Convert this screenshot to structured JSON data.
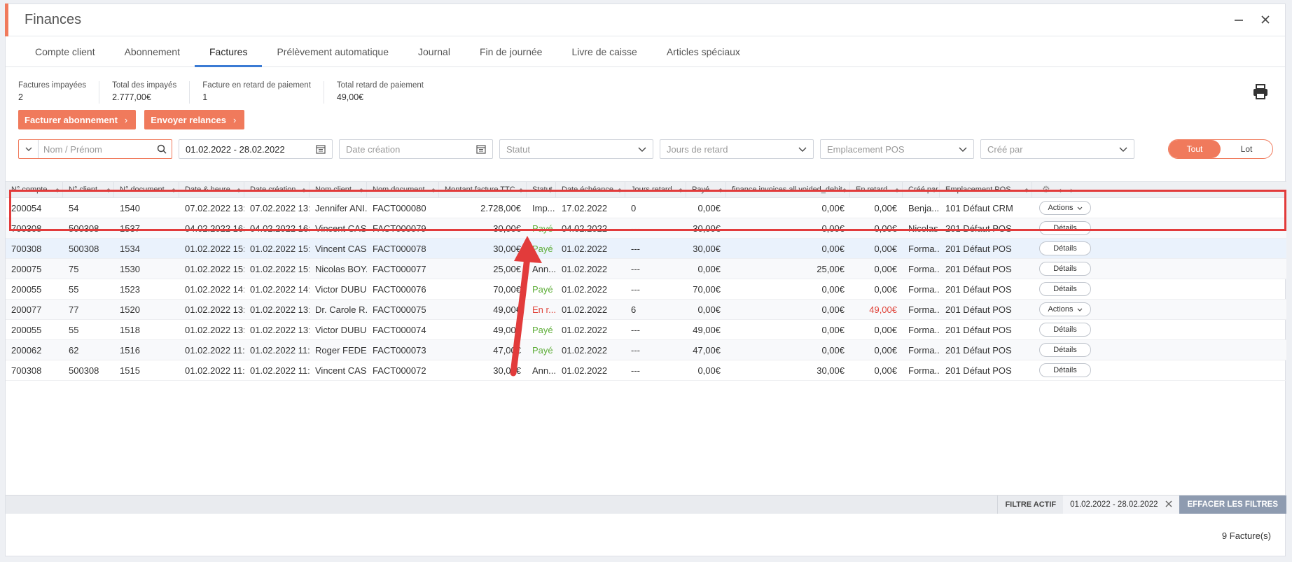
{
  "window": {
    "title": "Finances"
  },
  "tabs": [
    {
      "label": "Compte client",
      "active": false
    },
    {
      "label": "Abonnement",
      "active": false
    },
    {
      "label": "Factures",
      "active": true
    },
    {
      "label": "Prélèvement automatique",
      "active": false
    },
    {
      "label": "Journal",
      "active": false
    },
    {
      "label": "Fin de journée",
      "active": false
    },
    {
      "label": "Livre de caisse",
      "active": false
    },
    {
      "label": "Articles spéciaux",
      "active": false
    }
  ],
  "stats": [
    {
      "label": "Factures impayées",
      "value": "2"
    },
    {
      "label": "Total des impayés",
      "value": "2.777,00€"
    },
    {
      "label": "Facture en retard de paiement",
      "value": "1"
    },
    {
      "label": "Total retard de paiement",
      "value": "49,00€"
    }
  ],
  "actions": {
    "bill_label": "Facturer abonnement",
    "remind_label": "Envoyer relances"
  },
  "filters": {
    "name_placeholder": "Nom / Prénom",
    "date_range": "01.02.2022 - 28.02.2022",
    "date_creation_placeholder": "Date création",
    "statut_placeholder": "Statut",
    "jours_placeholder": "Jours de retard",
    "pos_placeholder": "Emplacement POS",
    "cree_placeholder": "Créé par",
    "toggle_all": "Tout",
    "toggle_lot": "Lot"
  },
  "columns": [
    "N° compte",
    "N° client",
    "N° document",
    "Date & heure",
    "Date création",
    "Nom client",
    "Nom document",
    "Montant facture TTC",
    "Statut",
    "Date échéance",
    "Jours retard",
    "Payé",
    "finance.invoices.all.voided_debit",
    "En retard",
    "Créé par",
    "Emplacement POS"
  ],
  "rows": [
    {
      "compte": "200054",
      "client": "54",
      "doc": "1540",
      "dateheure": "07.02.2022 13:...",
      "creation": "07.02.2022 13:...",
      "nom": "Jennifer ANI...",
      "nomdoc": "FACT000080",
      "montant": "2.728,00€",
      "statut": "Imp...",
      "statut_type": "imp",
      "echeance": "17.02.2022",
      "jours": "0",
      "paye": "0,00€",
      "voided": "0,00€",
      "retard": "0,00€",
      "cree": "Benja...",
      "pos": "101 Défaut CRM",
      "btn": "Actions"
    },
    {
      "compte": "700308",
      "client": "500308",
      "doc": "1537",
      "dateheure": "04.02.2022 16:...",
      "creation": "04.02.2022 16:...",
      "nom": "Vincent CAS...",
      "nomdoc": "FACT000079",
      "montant": "30,00€",
      "statut": "Payé",
      "statut_type": "paid",
      "echeance": "04.02.2022",
      "jours": "---",
      "paye": "30,00€",
      "voided": "0,00€",
      "retard": "0,00€",
      "cree": "Nicolas",
      "pos": "201 Défaut POS",
      "btn": "Détails"
    },
    {
      "compte": "700308",
      "client": "500308",
      "doc": "1534",
      "dateheure": "01.02.2022 15:...",
      "creation": "01.02.2022 15:...",
      "nom": "Vincent CAS...",
      "nomdoc": "FACT000078",
      "montant": "30,00€",
      "statut": "Payé",
      "statut_type": "paid",
      "echeance": "01.02.2022",
      "jours": "---",
      "paye": "30,00€",
      "voided": "0,00€",
      "retard": "0,00€",
      "cree": "Forma...",
      "pos": "201 Défaut POS",
      "btn": "Détails"
    },
    {
      "compte": "200075",
      "client": "75",
      "doc": "1530",
      "dateheure": "01.02.2022 15:...",
      "creation": "01.02.2022 15:...",
      "nom": "Nicolas BOY...",
      "nomdoc": "FACT000077",
      "montant": "25,00€",
      "statut": "Ann...",
      "statut_type": "ann",
      "echeance": "01.02.2022",
      "jours": "---",
      "paye": "0,00€",
      "voided": "25,00€",
      "retard": "0,00€",
      "cree": "Forma...",
      "pos": "201 Défaut POS",
      "btn": "Détails"
    },
    {
      "compte": "200055",
      "client": "55",
      "doc": "1523",
      "dateheure": "01.02.2022 14:...",
      "creation": "01.02.2022 14:...",
      "nom": "Victor DUBU...",
      "nomdoc": "FACT000076",
      "montant": "70,00€",
      "statut": "Payé",
      "statut_type": "paid",
      "echeance": "01.02.2022",
      "jours": "---",
      "paye": "70,00€",
      "voided": "0,00€",
      "retard": "0,00€",
      "cree": "Forma...",
      "pos": "201 Défaut POS",
      "btn": "Détails"
    },
    {
      "compte": "200077",
      "client": "77",
      "doc": "1520",
      "dateheure": "01.02.2022 13:...",
      "creation": "01.02.2022 13:...",
      "nom": "Dr. Carole R...",
      "nomdoc": "FACT000075",
      "montant": "49,00€",
      "statut": "En r...",
      "statut_type": "late",
      "echeance": "01.02.2022",
      "jours": "6",
      "paye": "0,00€",
      "voided": "0,00€",
      "retard": "49,00€",
      "cree": "Forma...",
      "pos": "201 Défaut POS",
      "btn": "Actions"
    },
    {
      "compte": "200055",
      "client": "55",
      "doc": "1518",
      "dateheure": "01.02.2022 13:...",
      "creation": "01.02.2022 13:...",
      "nom": "Victor DUBU...",
      "nomdoc": "FACT000074",
      "montant": "49,00€",
      "statut": "Payé",
      "statut_type": "paid",
      "echeance": "01.02.2022",
      "jours": "---",
      "paye": "49,00€",
      "voided": "0,00€",
      "retard": "0,00€",
      "cree": "Forma...",
      "pos": "201 Défaut POS",
      "btn": "Détails"
    },
    {
      "compte": "200062",
      "client": "62",
      "doc": "1516",
      "dateheure": "01.02.2022 11:...",
      "creation": "01.02.2022 11:...",
      "nom": "Roger FEDE...",
      "nomdoc": "FACT000073",
      "montant": "47,00€",
      "statut": "Payé",
      "statut_type": "paid",
      "echeance": "01.02.2022",
      "jours": "---",
      "paye": "47,00€",
      "voided": "0,00€",
      "retard": "0,00€",
      "cree": "Forma...",
      "pos": "201 Défaut POS",
      "btn": "Détails"
    },
    {
      "compte": "700308",
      "client": "500308",
      "doc": "1515",
      "dateheure": "01.02.2022 11:...",
      "creation": "01.02.2022 11:...",
      "nom": "Vincent CAS...",
      "nomdoc": "FACT000072",
      "montant": "30,00€",
      "statut": "Ann...",
      "statut_type": "ann",
      "echeance": "01.02.2022",
      "jours": "---",
      "paye": "0,00€",
      "voided": "30,00€",
      "retard": "0,00€",
      "cree": "Forma...",
      "pos": "201 Défaut POS",
      "btn": "Détails"
    }
  ],
  "footer": {
    "filter_label": "FILTRE ACTIF",
    "filter_value": "01.02.2022 - 28.02.2022",
    "clear_label": "EFFACER LES FILTRES",
    "count": "9 Facture(s)"
  },
  "colors": {
    "accent": "#f07a5c",
    "active_tab": "#3b7bd4",
    "paid": "#5fae3a",
    "late": "#e0463c",
    "annotation": "#e23b3b"
  }
}
